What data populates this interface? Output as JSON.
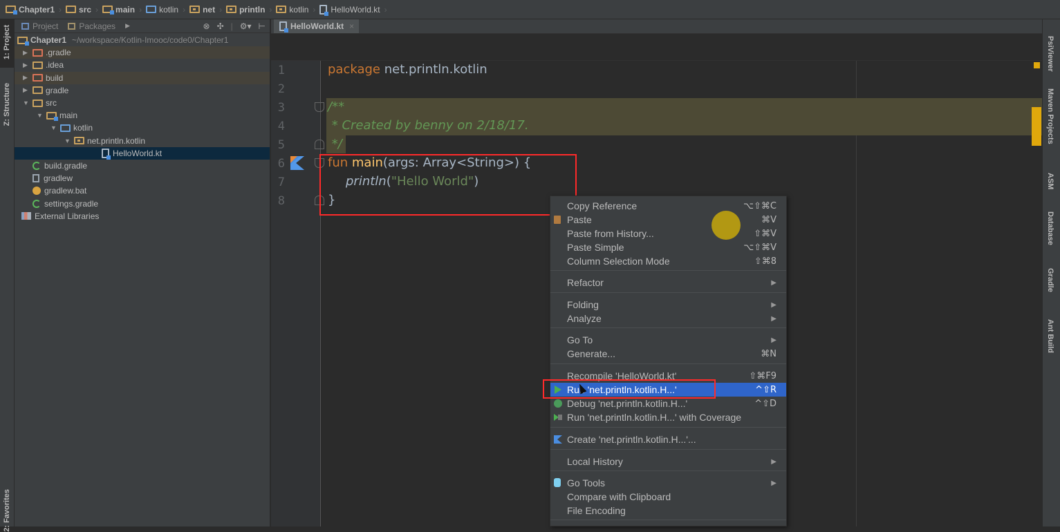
{
  "breadcrumb": [
    {
      "label": "Chapter1",
      "icon": "module-folder-icon"
    },
    {
      "label": "src",
      "icon": "folder-icon"
    },
    {
      "label": "main",
      "icon": "source-root-folder-icon"
    },
    {
      "label": "kotlin",
      "icon": "source-folder-icon"
    },
    {
      "label": "net",
      "icon": "package-folder-icon"
    },
    {
      "label": "println",
      "icon": "package-folder-icon"
    },
    {
      "label": "kotlin",
      "icon": "package-folder-icon"
    },
    {
      "label": "HelloWorld.kt",
      "icon": "kotlin-file-icon"
    }
  ],
  "left_strip": {
    "project": "1: Project",
    "structure": "Z: Structure",
    "favorites": "2: Favorites"
  },
  "project_panel": {
    "tabs": [
      "Project",
      "Packages"
    ],
    "toolbar_icons": [
      "scroll-from-source-icon",
      "collapse-all-icon",
      "settings-icon",
      "hide-panel-icon"
    ],
    "root": {
      "label": "Chapter1",
      "path": "~/workspace/Kotlin-Imooc/code0/Chapter1"
    },
    "items": [
      {
        "label": ".gradle",
        "indent": 1,
        "arrow": "▶",
        "icon": "excluded-folder-icon",
        "highlighted": true
      },
      {
        "label": ".idea",
        "indent": 1,
        "arrow": "▶",
        "icon": "folder-icon"
      },
      {
        "label": "build",
        "indent": 1,
        "arrow": "▶",
        "icon": "excluded-folder-icon",
        "highlighted": true
      },
      {
        "label": "gradle",
        "indent": 1,
        "arrow": "▶",
        "icon": "folder-icon"
      },
      {
        "label": "src",
        "indent": 1,
        "arrow": "▼",
        "icon": "folder-icon"
      },
      {
        "label": "main",
        "indent": 2,
        "arrow": "▼",
        "icon": "source-root-folder-icon"
      },
      {
        "label": "kotlin",
        "indent": 3,
        "arrow": "▼",
        "icon": "source-folder-icon"
      },
      {
        "label": "net.println.kotlin",
        "indent": 4,
        "arrow": "▼",
        "icon": "package-folder-icon"
      },
      {
        "label": "HelloWorld.kt",
        "indent": 6,
        "arrow": "",
        "icon": "kotlin-file-icon",
        "selected": true
      },
      {
        "label": "build.gradle",
        "indent": 1,
        "arrow": "",
        "icon": "gradle-icon"
      },
      {
        "label": "gradlew",
        "indent": 1,
        "arrow": "",
        "icon": "text-file-icon"
      },
      {
        "label": "gradlew.bat",
        "indent": 1,
        "arrow": "",
        "icon": "batch-file-icon"
      },
      {
        "label": "settings.gradle",
        "indent": 1,
        "arrow": "",
        "icon": "gradle-icon"
      },
      {
        "label": "External Libraries",
        "indent": 0,
        "arrow": "",
        "icon": "library-icon"
      }
    ]
  },
  "editor": {
    "tab": {
      "label": "HelloWorld.kt",
      "close": "×"
    },
    "line_numbers": [
      "1",
      "2",
      "3",
      "4",
      "5",
      "6",
      "7",
      "8"
    ],
    "lines": {
      "l1_kw": "package",
      "l1_rest": " net.println.kotlin",
      "l3": "/**",
      "l4": " * Created by benny on 2/18/17.",
      "l5": " */",
      "l6_kw": "fun",
      "l6_fn": " main",
      "l6_rest": "(args: Array<String>) {",
      "l7_call": "println",
      "l7_open": "(",
      "l7_str": "\"Hello World\"",
      "l7_close": ")",
      "l8": "}"
    }
  },
  "right_strip": [
    "PsiViewer",
    "Maven Projects",
    "ASM",
    "Database",
    "Gradle",
    "Ant Build"
  ],
  "context_menu": {
    "items": [
      {
        "label": "Copy Reference",
        "shortcut": "⌥⇧⌘C"
      },
      {
        "label": "Paste",
        "shortcut": "⌘V",
        "icon": "paste-icon"
      },
      {
        "label": "Paste from History...",
        "shortcut": "⇧⌘V"
      },
      {
        "label": "Paste Simple",
        "shortcut": "⌥⇧⌘V"
      },
      {
        "label": "Column Selection Mode",
        "shortcut": "⇧⌘8"
      },
      {
        "label": "Refactor",
        "submenu": "▶"
      },
      {
        "label": "Folding",
        "submenu": "▶"
      },
      {
        "label": "Analyze",
        "submenu": "▶"
      },
      {
        "label": "Go To",
        "submenu": "▶"
      },
      {
        "label": "Generate...",
        "shortcut": "⌘N"
      },
      {
        "label": "Recompile 'HelloWorld.kt'",
        "shortcut": "⇧⌘F9"
      },
      {
        "label": "Run 'net.println.kotlin.H...'",
        "shortcut": "^⇧R",
        "icon": "run-icon",
        "active": true
      },
      {
        "label": "Debug 'net.println.kotlin.H...'",
        "shortcut": "^⇧D",
        "icon": "debug-icon"
      },
      {
        "label": "Run 'net.println.kotlin.H...' with Coverage",
        "icon": "coverage-icon"
      },
      {
        "label": "Create 'net.println.kotlin.H...'...",
        "icon": "kotlin-icon"
      },
      {
        "label": "Local History",
        "submenu": "▶"
      },
      {
        "label": "Go Tools",
        "submenu": "▶",
        "icon": "go-tools-icon"
      },
      {
        "label": "Compare with Clipboard"
      },
      {
        "label": "File Encoding"
      }
    ]
  },
  "colors": {
    "keyword": "#cc7832",
    "function": "#ffc66d",
    "comment": "#629755",
    "string": "#6a8759",
    "selection": "#2f65ca",
    "annotation_red": "#ff2a2a",
    "marker": "#e0a80c"
  }
}
